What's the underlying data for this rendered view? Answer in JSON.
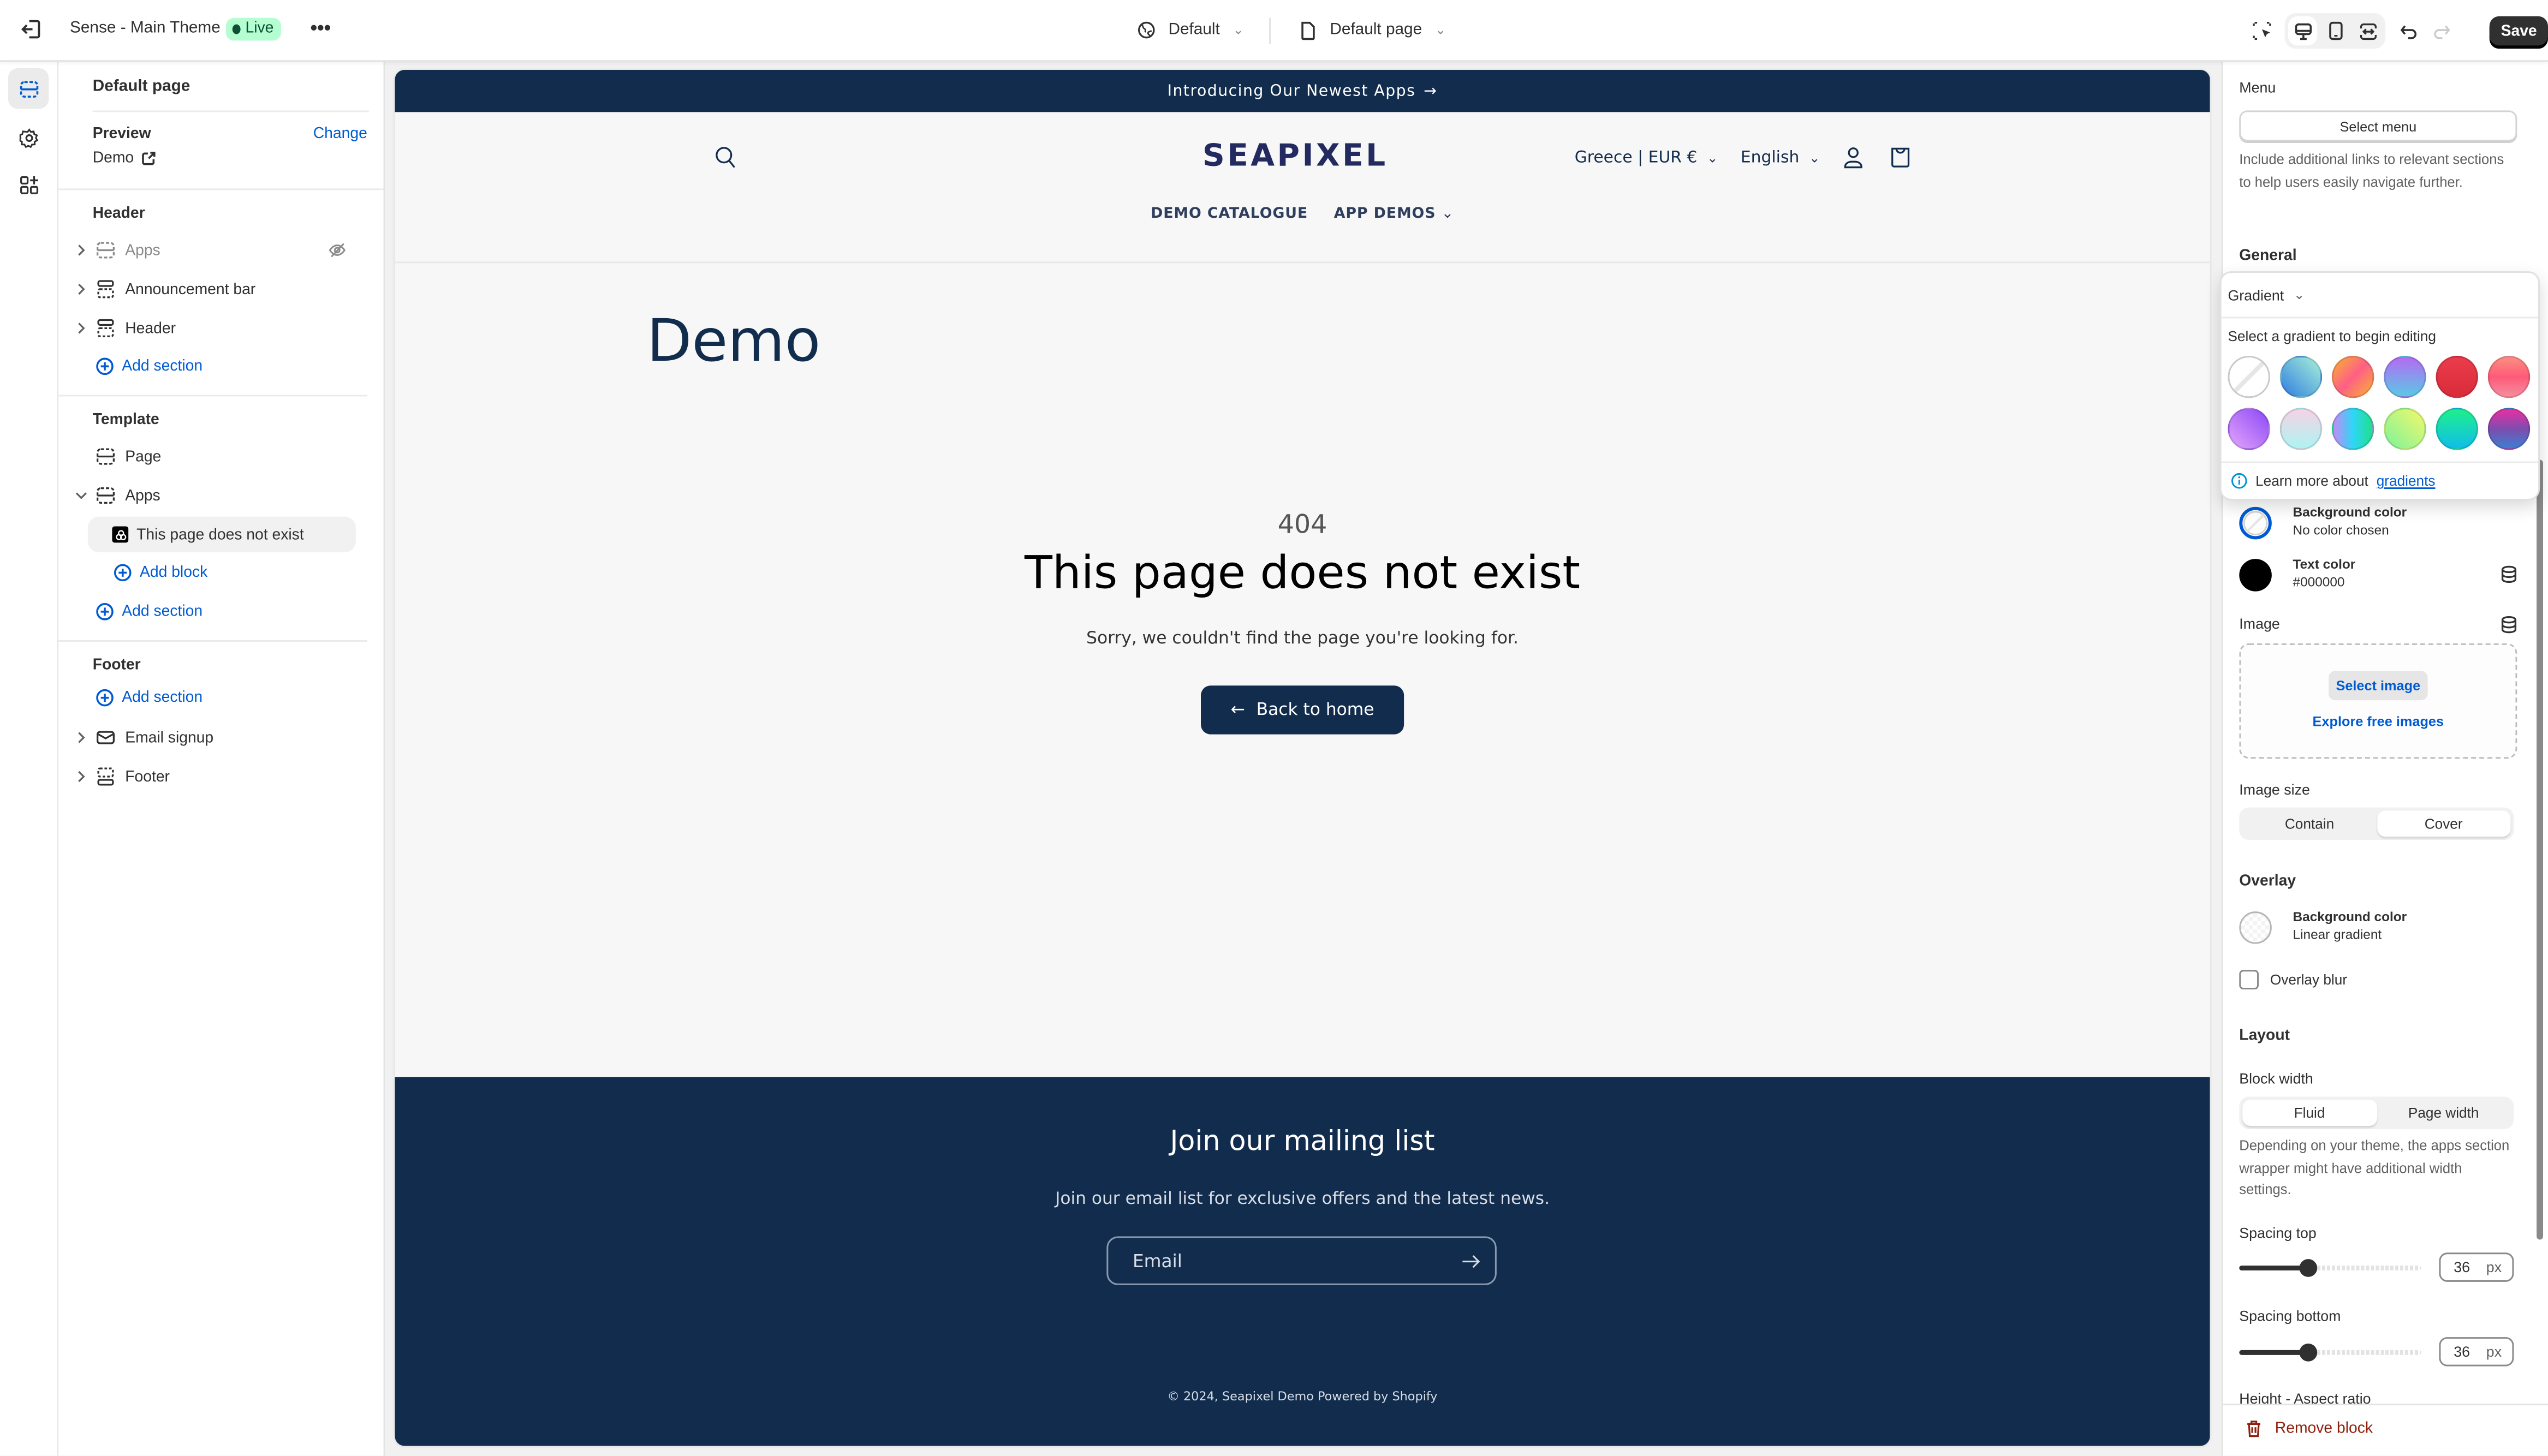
{
  "topbar": {
    "theme_name": "Sense - Main Theme",
    "status_badge": "Live",
    "more_label": "•••",
    "context_selector": "Default",
    "page_selector": "Default page",
    "save_label": "Save",
    "active_device": "desktop"
  },
  "rail": {
    "items": [
      {
        "icon": "sections-icon",
        "active": true
      },
      {
        "icon": "gear-icon",
        "active": false
      },
      {
        "icon": "add-apps-icon",
        "active": false
      }
    ]
  },
  "left_panel": {
    "title": "Default page",
    "preview_label": "Preview",
    "change_label": "Change",
    "preview_value": "Demo",
    "header_group": {
      "label": "Header",
      "items": [
        {
          "label": "Apps",
          "hidden": true
        },
        {
          "label": "Announcement bar"
        },
        {
          "label": "Header"
        }
      ],
      "add_label": "Add section"
    },
    "template_group": {
      "label": "Template",
      "items": [
        {
          "label": "Page"
        },
        {
          "label": "Apps",
          "expanded": true
        }
      ],
      "selected_block": "This page does not exist",
      "add_block_label": "Add block",
      "add_label": "Add section"
    },
    "footer_group": {
      "label": "Footer",
      "add_label": "Add section",
      "items": [
        {
          "label": "Email signup"
        },
        {
          "label": "Footer"
        }
      ]
    }
  },
  "preview": {
    "announcement": "Introducing Our Newest Apps",
    "logo": "SEAPIXEL",
    "country_selector": "Greece | EUR €",
    "language_selector": "English",
    "nav": [
      "DEMO CATALOGUE",
      "APP DEMOS"
    ],
    "page_title": "Demo",
    "error_code": "404",
    "error_title": "This page does not exist",
    "error_message": "Sorry, we couldn't find the page you're looking for.",
    "back_button": "Back to home",
    "newsletter_title": "Join our mailing list",
    "newsletter_text": "Join our email list for exclusive offers and the latest news.",
    "email_placeholder": "Email",
    "copyright": "© 2024, Seapixel Demo Powered by Shopify",
    "colors": {
      "brand_dark": "#112c4c",
      "logo": "#232a60"
    }
  },
  "right_panel": {
    "menu_label": "Menu",
    "select_menu": "Select menu",
    "menu_help": "Include additional links to relevant sections to help users easily navigate further.",
    "general_label": "General",
    "background_color_label": "Background color",
    "background_color_value": "No color chosen",
    "text_color_label": "Text color",
    "text_color_value": "#000000",
    "image_label": "Image",
    "select_image": "Select image",
    "explore_images": "Explore free images",
    "image_size_label": "Image size",
    "image_size_options": [
      "Contain",
      "Cover"
    ],
    "image_size_selected": "Cover",
    "overlay_label": "Overlay",
    "overlay_bg_label": "Background color",
    "overlay_bg_value": "Linear gradient",
    "overlay_blur_label": "Overlay blur",
    "overlay_blur_checked": false,
    "layout_label": "Layout",
    "block_width_label": "Block width",
    "block_width_options": [
      "Fluid",
      "Page width"
    ],
    "block_width_selected": "Fluid",
    "block_width_help": "Depending on your theme, the apps section wrapper might have additional width settings.",
    "spacing_top_label": "Spacing top",
    "spacing_top_value": "36",
    "spacing_top_fraction": 0.375,
    "spacing_bottom_label": "Spacing bottom",
    "spacing_bottom_value": "36",
    "spacing_bottom_fraction": 0.375,
    "unit": "px",
    "next_label": "Height - Aspect ratio",
    "remove_block": "Remove block"
  },
  "gradient_popover": {
    "type_label": "Gradient",
    "prompt": "Select a gradient to begin editing",
    "learn_prefix": "Learn more about",
    "learn_link": "gradients",
    "presets": [
      "none",
      "linear-gradient(225deg,#a8f0d8,#2f7ee0)",
      "linear-gradient(135deg,#f9b233,#fe5f85 50%,#f9b233)",
      "linear-gradient(180deg,#b46bf2,#5ac8e6)",
      "linear-gradient(180deg,#ea3c4b,#d92c3a)",
      "linear-gradient(180deg,#fd8e80,#fe5a78 50%,#f58da0)",
      "linear-gradient(45deg,#e3a4fb,#8b49f6)",
      "linear-gradient(180deg,#f6d3e6,#aef3f2)",
      "linear-gradient(90deg,#c28cf6,#2ed6f6 50%,#1fe08c)",
      "linear-gradient(45deg,#7cf39c,#f4f86b)",
      "linear-gradient(180deg,#1ef08c,#11bde9)",
      "linear-gradient(180deg,#e82fa3,#7d4dae 50%,#3d7ed1)"
    ]
  }
}
